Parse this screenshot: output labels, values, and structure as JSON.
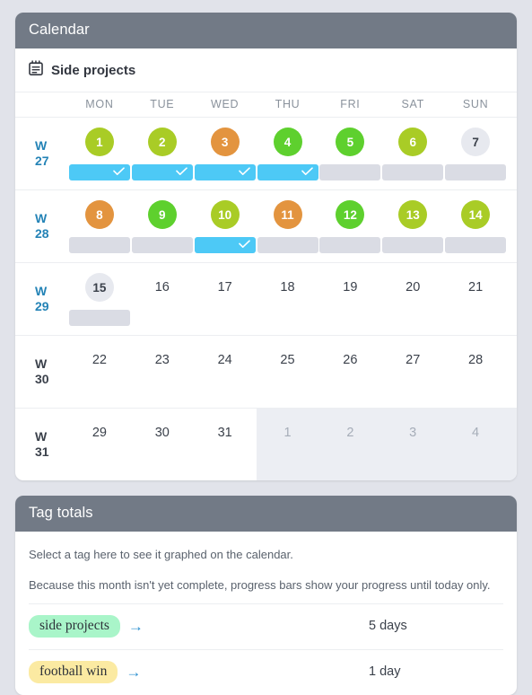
{
  "theme": {
    "page_bg": "#e1e3ea",
    "header_bg": "#727a86",
    "accent_blue": "#2483b6",
    "bar_done": "#4dc9f6",
    "bar_empty": "#dadce4",
    "green_bright": "#5ed02e",
    "green_yellow": "#a9cc26",
    "orange": "#e3943f",
    "gray_circle": "#e7e9ef"
  },
  "calendar": {
    "header_title": "Calendar",
    "subtitle": "Side projects",
    "subtitle_icon": "notepad-icon",
    "weekdays": [
      "MON",
      "TUE",
      "WED",
      "THU",
      "FRI",
      "SAT",
      "SUN"
    ],
    "weeks": [
      {
        "label_line1": "W",
        "label_line2": "27",
        "label_style": "blue",
        "days": [
          {
            "num": "1",
            "circle": "green-yellow",
            "bar": "done"
          },
          {
            "num": "2",
            "circle": "green-yellow",
            "bar": "done"
          },
          {
            "num": "3",
            "circle": "orange",
            "bar": "done"
          },
          {
            "num": "4",
            "circle": "green-bright",
            "bar": "done"
          },
          {
            "num": "5",
            "circle": "green-bright",
            "bar": "empty"
          },
          {
            "num": "6",
            "circle": "green-yellow",
            "bar": "empty"
          },
          {
            "num": "7",
            "circle": "gray",
            "bar": "empty"
          }
        ]
      },
      {
        "label_line1": "W",
        "label_line2": "28",
        "label_style": "blue",
        "days": [
          {
            "num": "8",
            "circle": "orange",
            "bar": "empty"
          },
          {
            "num": "9",
            "circle": "green-bright",
            "bar": "empty"
          },
          {
            "num": "10",
            "circle": "green-yellow",
            "bar": "done"
          },
          {
            "num": "11",
            "circle": "orange",
            "bar": "empty"
          },
          {
            "num": "12",
            "circle": "green-bright",
            "bar": "empty"
          },
          {
            "num": "13",
            "circle": "green-yellow",
            "bar": "empty"
          },
          {
            "num": "14",
            "circle": "green-yellow",
            "bar": "empty"
          }
        ]
      },
      {
        "label_line1": "W",
        "label_line2": "29",
        "label_style": "blue",
        "days": [
          {
            "num": "15",
            "circle": "today",
            "bar": "empty"
          },
          {
            "num": "16",
            "circle": "none",
            "bar": "none"
          },
          {
            "num": "17",
            "circle": "none",
            "bar": "none"
          },
          {
            "num": "18",
            "circle": "none",
            "bar": "none"
          },
          {
            "num": "19",
            "circle": "none",
            "bar": "none"
          },
          {
            "num": "20",
            "circle": "none",
            "bar": "none"
          },
          {
            "num": "21",
            "circle": "none",
            "bar": "none"
          }
        ]
      },
      {
        "label_line1": "W",
        "label_line2": "30",
        "label_style": "dark",
        "days": [
          {
            "num": "22",
            "circle": "none",
            "bar": "none"
          },
          {
            "num": "23",
            "circle": "none",
            "bar": "none"
          },
          {
            "num": "24",
            "circle": "none",
            "bar": "none"
          },
          {
            "num": "25",
            "circle": "none",
            "bar": "none"
          },
          {
            "num": "26",
            "circle": "none",
            "bar": "none"
          },
          {
            "num": "27",
            "circle": "none",
            "bar": "none"
          },
          {
            "num": "28",
            "circle": "none",
            "bar": "none"
          }
        ]
      },
      {
        "label_line1": "W",
        "label_line2": "31",
        "label_style": "dark",
        "shade_from_index": 3,
        "days": [
          {
            "num": "29",
            "circle": "none",
            "bar": "none"
          },
          {
            "num": "30",
            "circle": "none",
            "bar": "none"
          },
          {
            "num": "31",
            "circle": "none",
            "bar": "none"
          },
          {
            "num": "1",
            "circle": "muted",
            "bar": "none"
          },
          {
            "num": "2",
            "circle": "muted",
            "bar": "none"
          },
          {
            "num": "3",
            "circle": "muted",
            "bar": "none"
          },
          {
            "num": "4",
            "circle": "muted",
            "bar": "none"
          }
        ]
      }
    ]
  },
  "tag_totals": {
    "header_title": "Tag totals",
    "note_1": "Select a tag here to see it graphed on the calendar.",
    "note_2": "Because this month isn't yet complete, progress bars show your progress until today only.",
    "rows": [
      {
        "tag": "side projects",
        "pill_color": "#a9f5c9",
        "arrow": "→",
        "value": "5 days"
      },
      {
        "tag": "football win",
        "pill_color": "#fbeaa2",
        "arrow": "→",
        "value": "1 day"
      }
    ]
  }
}
